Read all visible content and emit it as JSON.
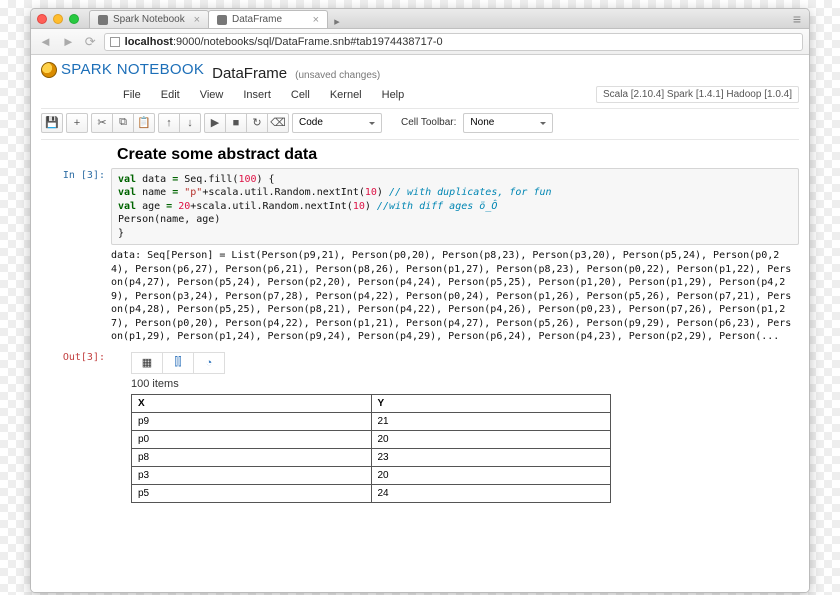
{
  "browser": {
    "tabs": [
      {
        "label": "Spark Notebook",
        "active": false
      },
      {
        "label": "DataFrame",
        "active": true
      }
    ],
    "url_host": "localhost",
    "url_path": ":9000/notebooks/sql/DataFrame.snb#tab1974438717-0"
  },
  "notebook": {
    "brand": "Spark Notebook",
    "title": "DataFrame",
    "unsaved": "(unsaved changes)",
    "menus": [
      "File",
      "Edit",
      "View",
      "Insert",
      "Cell",
      "Kernel",
      "Help"
    ],
    "env_label": "Scala [2.10.4] Spark [1.4.1] Hadoop [1.0.4]",
    "toolbar": {
      "cell_type": "Code",
      "cell_toolbar_label": "Cell Toolbar:",
      "cell_toolbar_value": "None"
    },
    "heading": "Create some abstract data",
    "in_prompt": "In [3]:",
    "out_prompt": "Out[3]:",
    "code": {
      "l1a": "val",
      "l1b": " data ",
      "l1c": "=",
      "l1d": " Seq",
      "l1e": ".fill(",
      "l1f": "100",
      "l1g": ") {",
      "l2a": "  val",
      "l2b": " name ",
      "l2c": "=",
      "l2d": " \"p\"",
      "l2e": "+scala.util.Random.nextInt(",
      "l2f": "10",
      "l2g": ")",
      "l2h": "  // with duplicates, for fun",
      "l3a": "  val",
      "l3b": " age ",
      "l3c": "=",
      "l3d": " 20",
      "l3e": "+scala.util.Random.nextInt(",
      "l3f": "10",
      "l3g": ")",
      "l3h": "  //with diff ages ö_Ô",
      "l4": "  Person(name, age)",
      "l5": "}"
    },
    "output_text": "data: Seq[Person] = List(Person(p9,21), Person(p0,20), Person(p8,23), Person(p3,20), Person(p5,24), Person(p0,24), Person(p6,27), Person(p6,21), Person(p8,26), Person(p1,27), Person(p8,23), Person(p0,22), Person(p1,22), Person(p4,27), Person(p5,24), Person(p2,20), Person(p4,24), Person(p5,25), Person(p1,20), Person(p1,29), Person(p4,29), Person(p3,24), Person(p7,28), Person(p4,22), Person(p0,24), Person(p1,26), Person(p5,26), Person(p7,21), Person(p4,28), Person(p5,25), Person(p8,21), Person(p4,22), Person(p4,26), Person(p0,23), Person(p7,26), Person(p1,27), Person(p0,20), Person(p4,22), Person(p1,21), Person(p4,27), Person(p5,26), Person(p9,29), Person(p6,23), Person(p1,29), Person(p1,24), Person(p9,24), Person(p4,29), Person(p6,24), Person(p4,23), Person(p2,29), Person(...",
    "items_label": "100 items",
    "table": {
      "headers": [
        "X",
        "Y"
      ],
      "rows": [
        [
          "p9",
          "21"
        ],
        [
          "p0",
          "20"
        ],
        [
          "p8",
          "23"
        ],
        [
          "p3",
          "20"
        ],
        [
          "p5",
          "24"
        ]
      ]
    }
  }
}
